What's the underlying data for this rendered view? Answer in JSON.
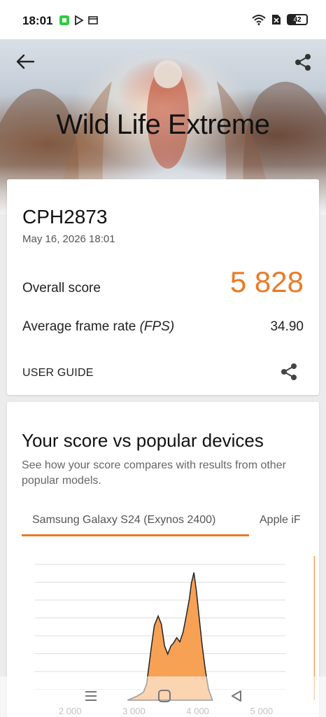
{
  "status_bar": {
    "time": "18:01",
    "icons": [
      "app-notification-icon",
      "play-store-icon",
      "window-icon"
    ],
    "right_icons": [
      "wifi-icon",
      "sim-x-icon",
      "battery-icon"
    ],
    "battery_level": "42"
  },
  "hero": {
    "title": "Wild Life Extreme",
    "back_icon": "arrow-back-icon",
    "share_icon": "share-icon"
  },
  "result": {
    "device": "CPH2873",
    "date": "May 16, 2026 18:01",
    "overall_label": "Overall score",
    "overall_value": "5 828",
    "fps_label": "Average frame rate",
    "fps_unit": "(FPS)",
    "fps_value": "34.90",
    "user_guide": "USER GUIDE",
    "accent_color": "#ea7a27"
  },
  "comparison": {
    "title": "Your score vs popular devices",
    "description": "See how your score compares with results from other popular models.",
    "tabs": [
      "Samsung Galaxy S24 (Exynos 2400)",
      "Apple iF"
    ],
    "selected_tab": 0
  },
  "chart_data": {
    "type": "area",
    "title": "",
    "xlabel": "",
    "ylabel": "",
    "x_ticks": [
      "2 000",
      "3 000",
      "4 000",
      "5 000"
    ],
    "xlim": [
      1450,
      5900
    ],
    "ylim": [
      0,
      1.0
    ],
    "fill_color": "#f7a155",
    "marker_x": 5828,
    "series": [
      {
        "x": [
          2900,
          3050,
          3150,
          3200,
          3270,
          3320,
          3380,
          3430,
          3480,
          3530,
          3580,
          3620,
          3670,
          3720,
          3770,
          3820,
          3870,
          3900,
          3940,
          3980,
          4020,
          4070,
          4120,
          4170,
          4230
        ],
        "values": [
          0.0,
          0.03,
          0.06,
          0.12,
          0.38,
          0.55,
          0.62,
          0.56,
          0.4,
          0.34,
          0.4,
          0.42,
          0.46,
          0.43,
          0.5,
          0.62,
          0.75,
          0.86,
          0.94,
          0.8,
          0.62,
          0.4,
          0.22,
          0.08,
          0.0
        ]
      }
    ]
  },
  "nav_bar": {
    "buttons": [
      "menu-icon",
      "home-icon",
      "back-triangle-icon"
    ]
  }
}
